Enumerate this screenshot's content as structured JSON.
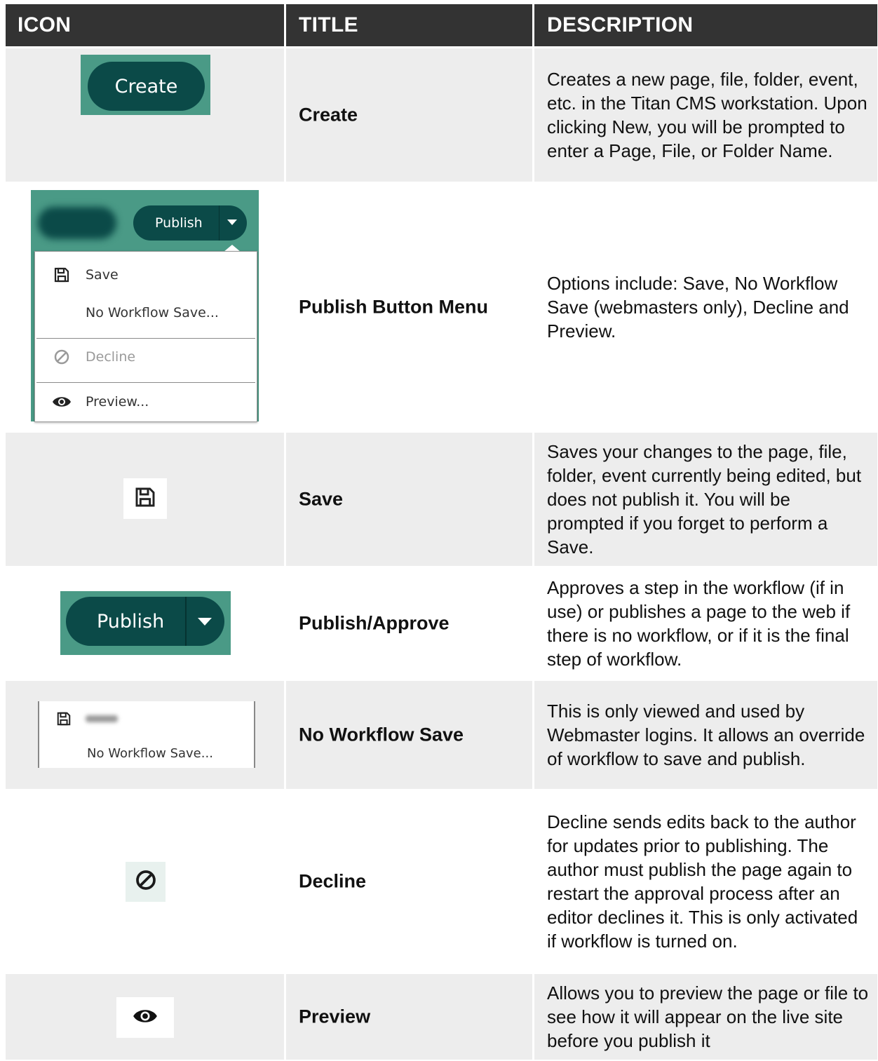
{
  "header": {
    "icon": "ICON",
    "title": "TITLE",
    "description": "DESCRIPTION"
  },
  "rows": [
    {
      "title": "Create",
      "description": "Creates a new page, file, folder, event, etc. in the Titan CMS workstation. Upon clicking New, you will be prompted to enter a Page, File, or Folder Name.",
      "icon": {
        "button_label": "Create"
      }
    },
    {
      "title": "Publish Button Menu",
      "description": "Options include: Save, No Workflow Save (webmasters only), Decline and Preview.",
      "icon": {
        "publish_label": "Publish",
        "menu": [
          "Save",
          "No Workflow Save...",
          "Decline",
          "Preview..."
        ]
      }
    },
    {
      "title": "Save",
      "description": "Saves your changes to the page, file, folder, event currently being edited, but does not publish it. You will be prompted if you forget to perform a Save.",
      "icon": {
        "name": "save-icon"
      }
    },
    {
      "title": "Publish/Approve",
      "description": "Approves a step in the workflow (if in use) or publishes a page to the web if there is no workflow, or if it is the final step of workflow.",
      "icon": {
        "publish_label": "Publish"
      }
    },
    {
      "title": "No Workflow Save",
      "description": "This is only viewed and used by Webmaster logins. It allows an override of workflow to save and publish.",
      "icon": {
        "menu_label": "No Workflow Save..."
      }
    },
    {
      "title": "Decline",
      "description": "Decline sends edits back to the author for updates prior to publishing. The author must publish the page again to restart the approval process after an editor declines it. This is only activated if workflow is turned on.",
      "icon": {
        "name": "decline-icon"
      }
    },
    {
      "title": "Preview",
      "description": "Allows you to preview the page or file to see how it will appear on the live site before you publish it",
      "icon": {
        "name": "eye-icon"
      }
    }
  ],
  "colors": {
    "header_bg": "#333333",
    "teal": "#4a9a86",
    "dark_teal": "#0b4a48",
    "row_grey": "#ededed"
  }
}
